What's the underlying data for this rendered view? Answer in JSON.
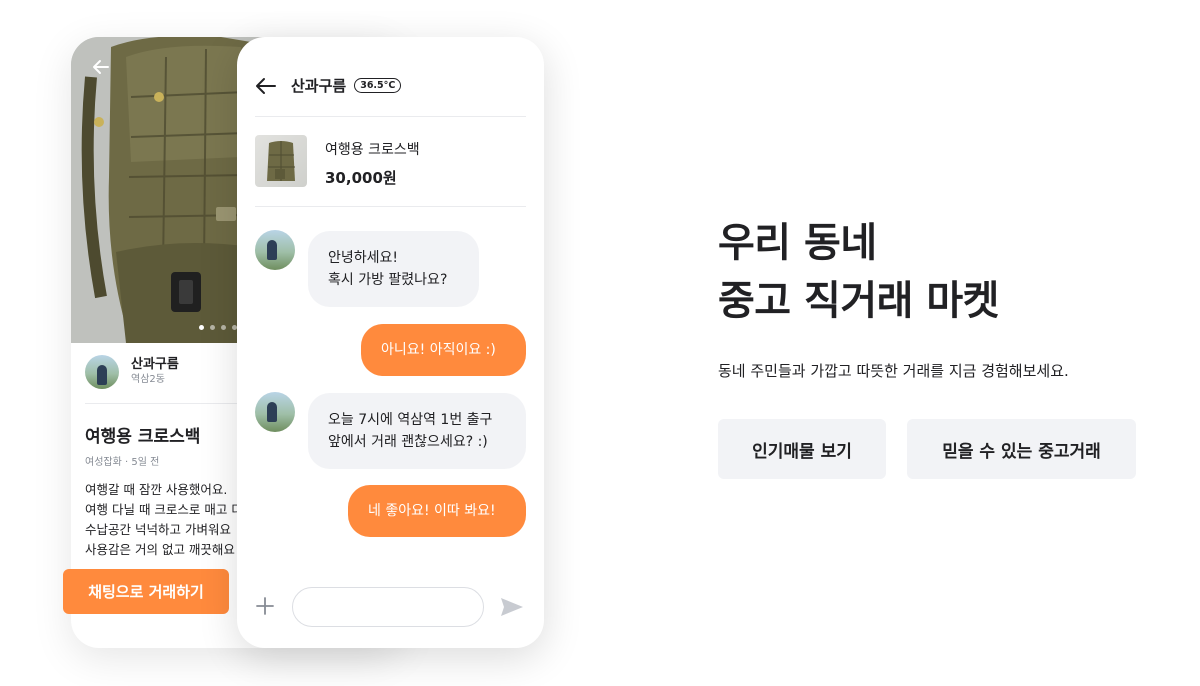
{
  "product_page": {
    "seller_name": "산과구름",
    "seller_location": "역삼2동",
    "title": "여행용 크로스백",
    "meta": "여성잡화 · 5일 전",
    "description_lines": [
      "여행갈 때 잠깐 사용했어요.",
      "여행 다닐 때 크로스로 매고 다",
      "수납공간 넉넉하고 가벼워요",
      "사용감은 거의 없고 깨끗해요"
    ],
    "cta_label": "채팅으로 거래하기",
    "photo_slide_count": 4,
    "photo_active_slide": 1
  },
  "chat": {
    "partner_name": "산과구름",
    "manner_temp": "36.5°C",
    "item_name": "여행용 크로스백",
    "item_price": "30,000원",
    "messages": [
      {
        "from": "partner",
        "lines": [
          "안녕하세요!",
          "혹시 가방 팔렸나요?"
        ]
      },
      {
        "from": "me",
        "lines": [
          "아니요! 아직이요 :)"
        ]
      },
      {
        "from": "partner",
        "lines": [
          "오늘 7시에 역삼역 1번 출구",
          "앞에서 거래 괜찮으세요? :)"
        ]
      },
      {
        "from": "me",
        "lines": [
          "네 좋아요! 이따 봐요!"
        ]
      }
    ],
    "input_value": ""
  },
  "hero": {
    "headline_line1": "우리 동네",
    "headline_line2": "중고 직거래 마켓",
    "subcopy": "동네 주민들과 가깝고 따뜻한 거래를 지금 경험해보세요.",
    "button_popular": "인기매물 보기",
    "button_trusted": "믿을 수 있는 중고거래"
  },
  "icons": {
    "back": "arrow-left-icon",
    "add": "plus-icon",
    "send": "send-icon"
  },
  "colors": {
    "accent": "#ff8a3d",
    "bubble_in": "#f2f3f6",
    "text": "#212124",
    "muted": "#868b94"
  }
}
